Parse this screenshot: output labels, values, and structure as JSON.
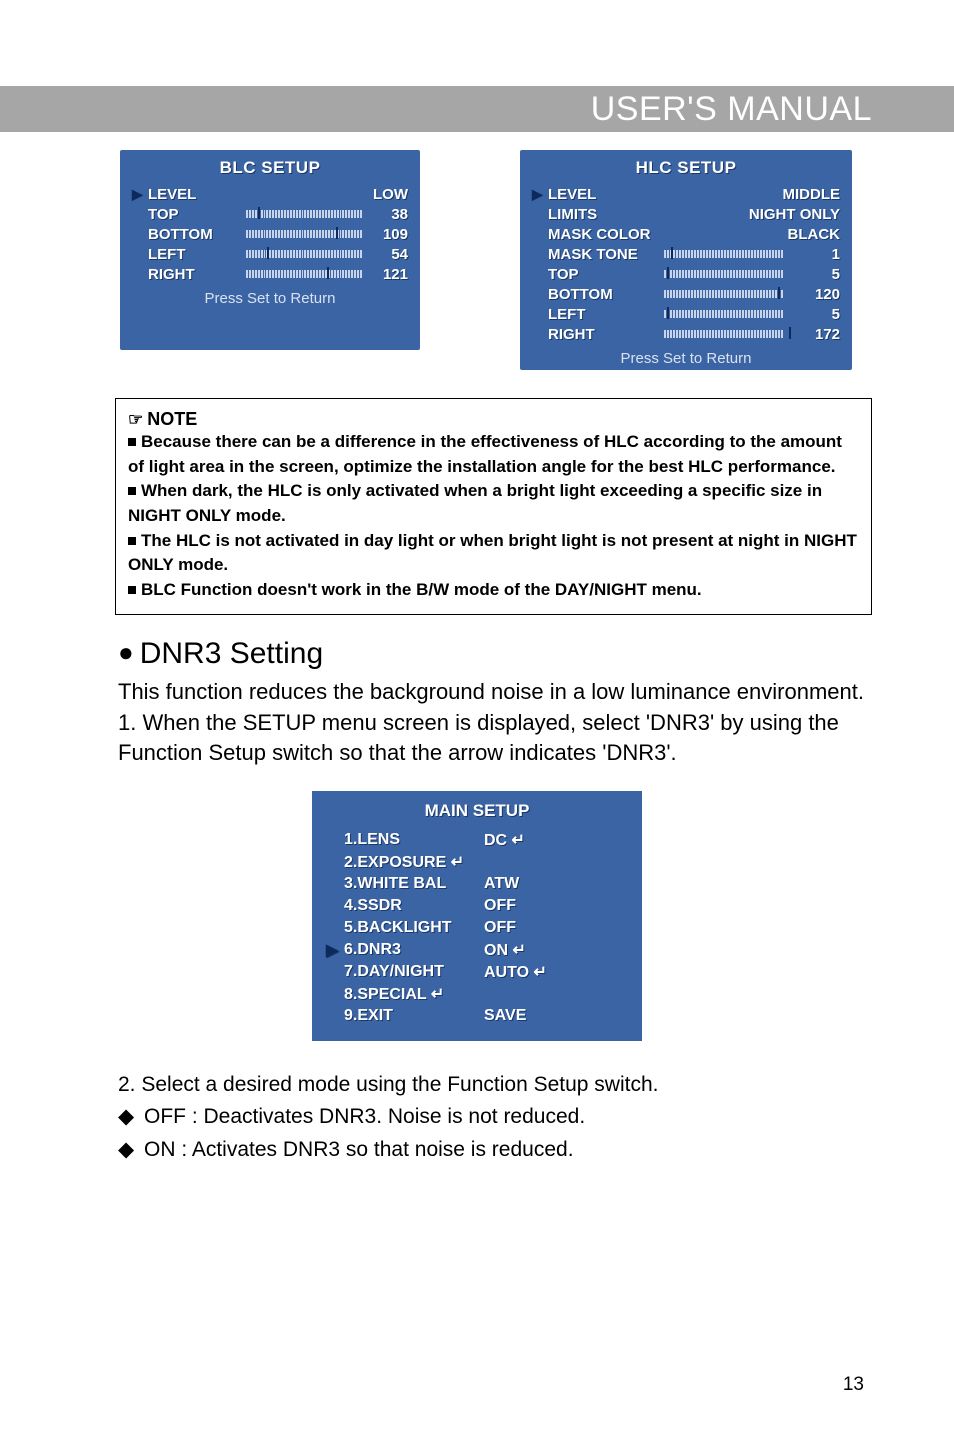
{
  "header": {
    "title": "USER'S MANUAL"
  },
  "blc": {
    "title": "BLC SETUP",
    "rows": [
      {
        "label": "LEVEL",
        "value": "LOW",
        "slider": false,
        "marker": true
      },
      {
        "label": "TOP",
        "value": "38",
        "slider": true,
        "thumb_pct": 10
      },
      {
        "label": "BOTTOM",
        "value": "109",
        "slider": true,
        "thumb_pct": 78
      },
      {
        "label": "LEFT",
        "value": "54",
        "slider": true,
        "thumb_pct": 18
      },
      {
        "label": "RIGHT",
        "value": "121",
        "slider": true,
        "thumb_pct": 70
      }
    ],
    "footer": "Press Set to Return"
  },
  "hlc": {
    "title": "HLC SETUP",
    "rows": [
      {
        "label": "LEVEL",
        "value": "MIDDLE",
        "slider": false,
        "marker": true
      },
      {
        "label": "LIMITS",
        "value": "NIGHT ONLY",
        "slider": false
      },
      {
        "label": "MASK COLOR",
        "value": "BLACK",
        "slider": false
      },
      {
        "label": "MASK TONE",
        "value": "1",
        "slider": true,
        "thumb_pct": 5
      },
      {
        "label": "TOP",
        "value": "5",
        "slider": true,
        "thumb_pct": 2
      },
      {
        "label": "BOTTOM",
        "value": "120",
        "slider": true,
        "thumb_pct": 88
      },
      {
        "label": "LEFT",
        "value": "5",
        "slider": true,
        "thumb_pct": 2
      },
      {
        "label": "RIGHT",
        "value": "172",
        "slider": true,
        "thumb_pct": 96
      }
    ],
    "footer": "Press Set to Return"
  },
  "note": {
    "head": "NOTE",
    "lines": [
      "Because there can be a difference in the effectiveness of HLC according to the amount of light area in the screen, optimize the installation angle for the best HLC performance.",
      "When dark, the HLC is only activated when a bright light exceeding a specific size in NIGHT ONLY mode.",
      "The HLC is not activated in day light or when bright light is not present at night in NIGHT ONLY mode.",
      "BLC Function doesn't work in the B/W mode of the DAY/NIGHT menu."
    ]
  },
  "dnr3": {
    "heading": "DNR3 Setting",
    "intro": "This function reduces the background noise in a low luminance environment.",
    "step1": "1. When the SETUP menu screen is displayed, select 'DNR3' by using the Function Setup switch so that the arrow indicates 'DNR3'."
  },
  "main_setup": {
    "title": "MAIN SETUP",
    "rows": [
      {
        "label": "1.LENS",
        "value": "DC ↵",
        "marker": false
      },
      {
        "label": "2.EXPOSURE ↵",
        "value": "",
        "marker": false
      },
      {
        "label": "3.WHITE BAL",
        "value": "ATW",
        "marker": false
      },
      {
        "label": "4.SSDR",
        "value": "OFF",
        "marker": false
      },
      {
        "label": "5.BACKLIGHT",
        "value": "OFF",
        "marker": false
      },
      {
        "label": "6.DNR3",
        "value": "ON ↵",
        "marker": true
      },
      {
        "label": "7.DAY/NIGHT",
        "value": "AUTO ↵",
        "marker": false
      },
      {
        "label": "8.SPECIAL ↵",
        "value": "",
        "marker": false
      },
      {
        "label": "9.EXIT",
        "value": "SAVE",
        "marker": false
      }
    ]
  },
  "body2": {
    "step2": "2. Select a desired mode using the Function Setup switch.",
    "off": "OFF : Deactivates DNR3. Noise is not reduced.",
    "on": "ON : Activates DNR3 so that noise is reduced."
  },
  "page_no": "13",
  "colors": {
    "panel_bg": "#3b64a4",
    "band_bg": "#a6a6a6"
  }
}
